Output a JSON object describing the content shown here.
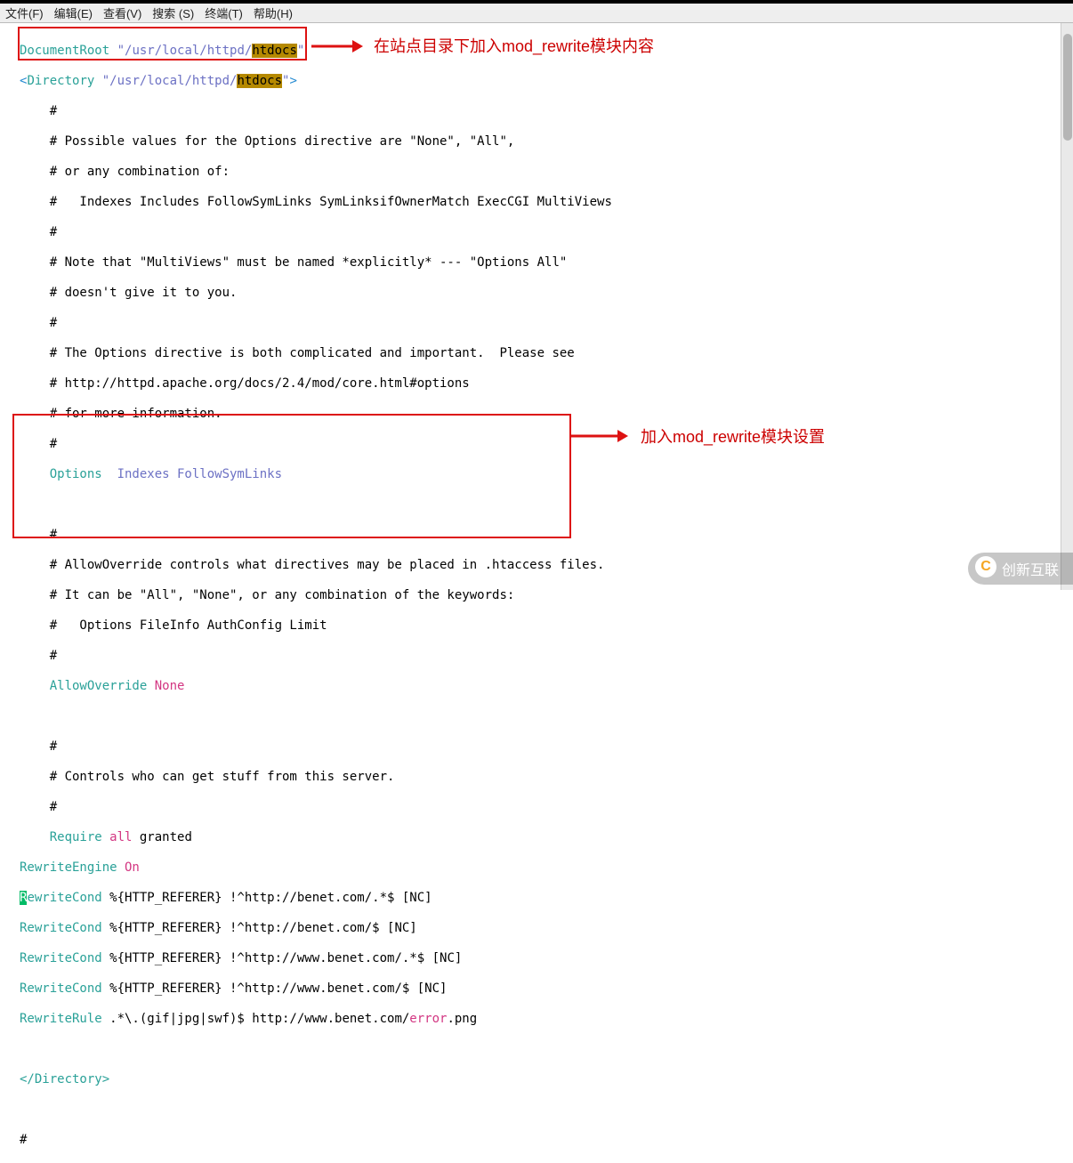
{
  "menubar": {
    "file": "文件(F)",
    "edit": "编辑(E)",
    "view": "查看(V)",
    "search": "搜索 (S)",
    "terminal": "终端(T)",
    "help": "帮助(H)"
  },
  "annotations": {
    "anno1": "在站点目录下加入mod_rewrite模块内容",
    "anno2": "加入mod_rewrite模块设置"
  },
  "code": {
    "docroot_key": "DocumentRoot",
    "docroot_path_prefix": "\"/usr/local/httpd/",
    "docroot_hl": "htdocs",
    "docroot_path_suffix": "\"",
    "dir_open_lt": "<",
    "dir_key": "Directory",
    "dir_path_prefix": " \"/usr/local/httpd/",
    "dir_hl": "htdocs",
    "dir_path_suffix": "\"",
    "dir_open_gt": ">",
    "comment_block": [
      "    #",
      "    # Possible values for the Options directive are \"None\", \"All\",",
      "    # or any combination of:",
      "    #   Indexes Includes FollowSymLinks SymLinksifOwnerMatch ExecCGI MultiViews",
      "    #",
      "    # Note that \"MultiViews\" must be named *explicitly* --- \"Options All\"",
      "    # doesn't give it to you.",
      "    #",
      "    # The Options directive is both complicated and important.  Please see",
      "    # http://httpd.apache.org/docs/2.4/mod/core.html#options",
      "    # for more information.",
      "    #"
    ],
    "options_key": "    Options",
    "options_val": "  Indexes FollowSymLinks",
    "allowoverride_comments": [
      "",
      "    #",
      "    # AllowOverride controls what directives may be placed in .htaccess files.",
      "    # It can be \"All\", \"None\", or any combination of the keywords:",
      "    #   Options FileInfo AuthConfig Limit",
      "    #"
    ],
    "allowoverride_key": "    AllowOverride",
    "allowoverride_val": " None",
    "controls_comments": [
      "",
      "    #",
      "    # Controls who can get stuff from this server.",
      "    #"
    ],
    "require_key": "    Require",
    "require_all": " all",
    "require_granted": " granted",
    "rewrite_engine_key": "RewriteEngine",
    "rewrite_engine_val": " On",
    "rewrite_cond_key": "RewriteCond",
    "rewrite_cond_first_R": "R",
    "rewrite_cond_first_rest": "ewriteCond",
    "conds": [
      " %{HTTP_REFERER} !^http://benet.com/.*$ [NC]",
      " %{HTTP_REFERER} !^http://benet.com/$ [NC]",
      " %{HTTP_REFERER} !^http://www.benet.com/.*$ [NC]",
      " %{HTTP_REFERER} !^http://www.benet.com/$ [NC]"
    ],
    "rewrite_rule_key": "RewriteRule",
    "rewrite_rule_pre": " .*\\.(gif|jpg|swf)$ http://www.benet.com/",
    "rewrite_rule_err": "error",
    "rewrite_rule_post": ".png",
    "dir_close": "</Directory>",
    "trailing_hash": "#"
  },
  "watermark": {
    "text": "创新互联",
    "icon": "C"
  }
}
